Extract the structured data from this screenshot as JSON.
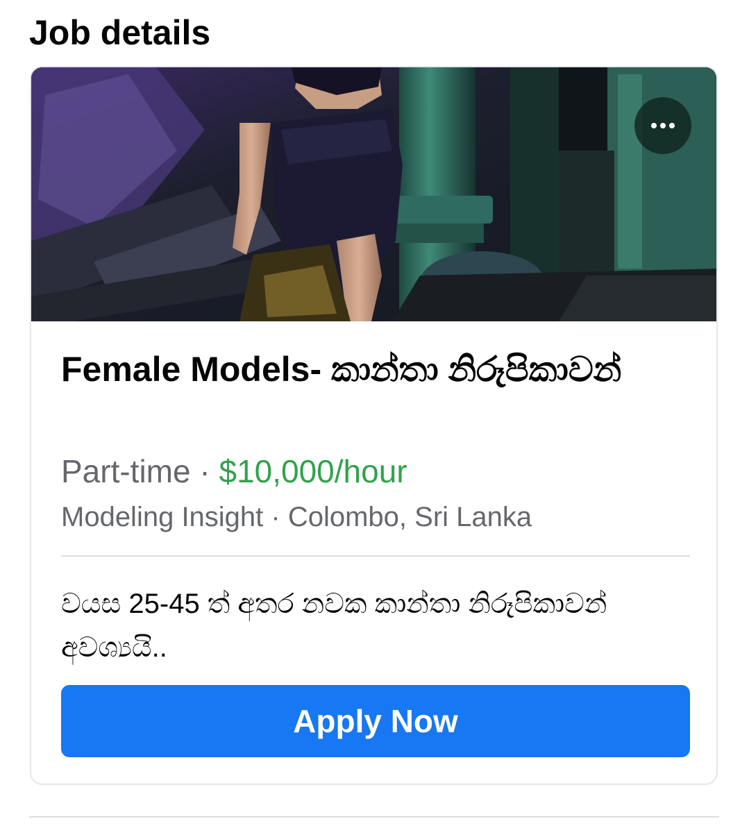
{
  "page": {
    "heading": "Job details"
  },
  "job": {
    "title": "Female Models- කාන්තා නිරූපිකාවන්",
    "employment_type": "Part-time",
    "separator": " · ",
    "pay": "$10,000/hour",
    "company": "Modeling Insight",
    "location": "Colombo, Sri Lanka",
    "description": "වයස 25-45 ත් අතර නවක කාන්තා නිරූපිකාවන් අවශ්‍යයි..",
    "apply_label": "Apply Now"
  },
  "icons": {
    "more": "more-options-icon"
  },
  "colors": {
    "accent": "#1877f2",
    "pay": "#31a24c",
    "secondary_text": "#65676b"
  }
}
